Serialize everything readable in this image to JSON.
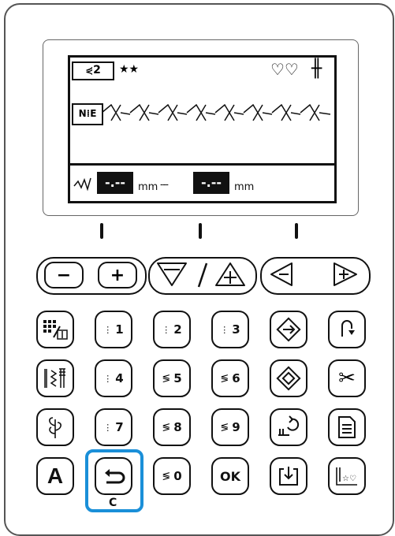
{
  "lcd": {
    "pattern_code": "2",
    "pattern_prefix_icon": "pattern-category-icon",
    "stars": "★★",
    "top_right_icons": [
      "heart-pair-icon",
      "double-needle-icon"
    ],
    "stitch_mode_icon": "needle-stitch-icon",
    "width_value": "-.--",
    "length_value": "-.--",
    "width_unit": "mm",
    "length_unit": "mm"
  },
  "controls": {
    "width_minus": "−",
    "width_plus": "+",
    "length_minus": "−",
    "length_plus": "+",
    "slash": "/",
    "left": "◁",
    "right": "▷"
  },
  "keys": {
    "row1": [
      "",
      "1",
      "2",
      "3",
      "",
      ""
    ],
    "row2": [
      "",
      "4",
      "5",
      "6",
      "",
      ""
    ],
    "row3": [
      "",
      "7",
      "8",
      "9",
      "",
      ""
    ],
    "row4": [
      "A",
      "",
      "0",
      "OK",
      "",
      ""
    ]
  },
  "callout_label": "C",
  "highlight_color": "#1a8fd8"
}
